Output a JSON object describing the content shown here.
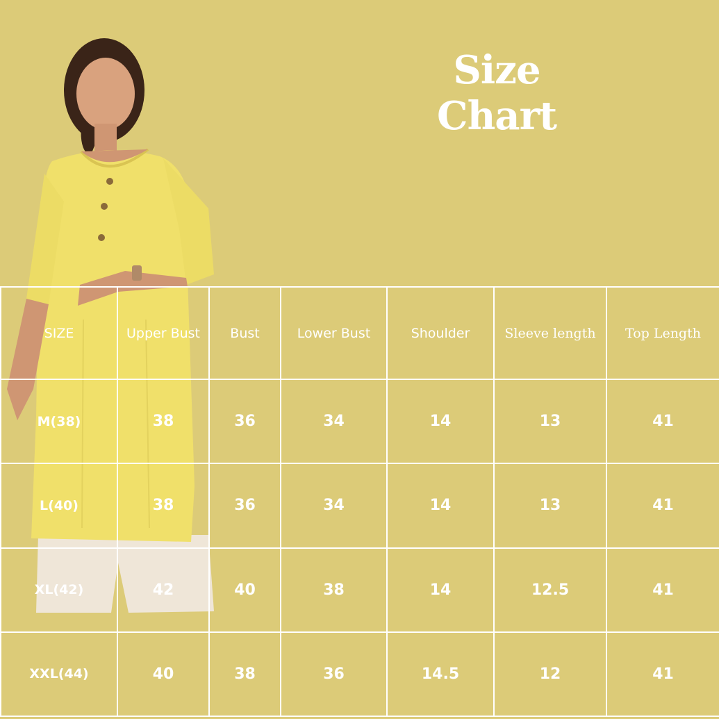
{
  "colors": {
    "background": "#dccb78",
    "text": "#ffffff",
    "grid_lines": "#ffffff",
    "kurta": "#f0e06a",
    "pants": "#efe6d8"
  },
  "title": "Size Chart",
  "model_image": "model-wearing-yellow-kurta-and-white-pants",
  "table": {
    "headers": [
      "SIZE",
      "Upper Bust",
      "Bust",
      "Lower Bust",
      "Shoulder",
      "Sleeve length",
      "Top Length"
    ],
    "rows": [
      [
        "M(38)",
        "38",
        "36",
        "34",
        "14",
        "13",
        "41"
      ],
      [
        "L(40)",
        "38",
        "36",
        "34",
        "14",
        "13",
        "41"
      ],
      [
        "XL(42)",
        "42",
        "40",
        "38",
        "14",
        "12.5",
        "41"
      ],
      [
        "XXL(44)",
        "40",
        "38",
        "36",
        "14.5",
        "12",
        "41"
      ]
    ]
  }
}
